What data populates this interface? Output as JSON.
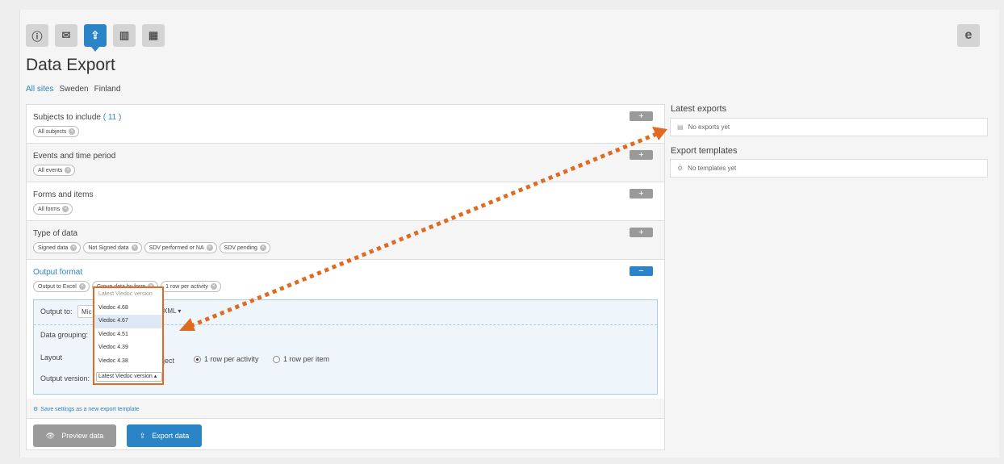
{
  "header": {
    "tabs": [
      {
        "icon": "info-icon",
        "glyph": "ⓘ"
      },
      {
        "icon": "mail-icon",
        "glyph": "✉"
      },
      {
        "icon": "export-icon",
        "glyph": "⇪"
      },
      {
        "icon": "chart-icon",
        "glyph": "▥"
      },
      {
        "icon": "calendar-icon",
        "glyph": "▦"
      }
    ],
    "ie_glyph": "e",
    "title": "Data Export"
  },
  "sites": {
    "all": "All sites",
    "sweden": "Sweden",
    "finland": "Finland"
  },
  "sections": {
    "subjects": {
      "title": "Subjects to include",
      "count": "( 11 )",
      "chips": [
        "All subjects"
      ]
    },
    "events": {
      "title": "Events and time period",
      "chips": [
        "All events"
      ]
    },
    "forms": {
      "title": "Forms and items",
      "chips": [
        "All forms"
      ]
    },
    "datatype": {
      "title": "Type of data",
      "chips": [
        "Signed data",
        "Not Signed data",
        "SDV performed or NA",
        "SDV pending"
      ]
    },
    "output": {
      "title": "Output format",
      "chips": [
        "Output to Excel",
        "Group data by form",
        "1 row per activity"
      ],
      "output_to_label": "Output to:",
      "output_to_value_partial": "Mic",
      "output_to_suffix": "XML",
      "grouping_label": "Data grouping:",
      "layout_label": "Layout",
      "layout_partial": "ject",
      "layout_options": [
        "1 row per activity",
        "1 row per item"
      ],
      "version_label": "Output version:"
    }
  },
  "plus": "+",
  "minus": "−",
  "dropdown": {
    "header": "Latest Viedoc version",
    "options": [
      "Viedoc 4.68",
      "Viedoc 4.67",
      "Viedoc 4.51",
      "Viedoc 4.39",
      "Viedoc 4.38"
    ],
    "selected": "Viedoc 4.67",
    "current": "Latest Viedoc version"
  },
  "footer": {
    "save_link": "Save settings as a new export template",
    "preview": "Preview data",
    "export": "Export data"
  },
  "right": {
    "latest_title": "Latest exports",
    "latest_empty": "No exports yet",
    "templates_title": "Export templates",
    "templates_empty": "No templates yet"
  },
  "colors": {
    "accent": "#2b84c6",
    "annotation": "#e06a20"
  }
}
